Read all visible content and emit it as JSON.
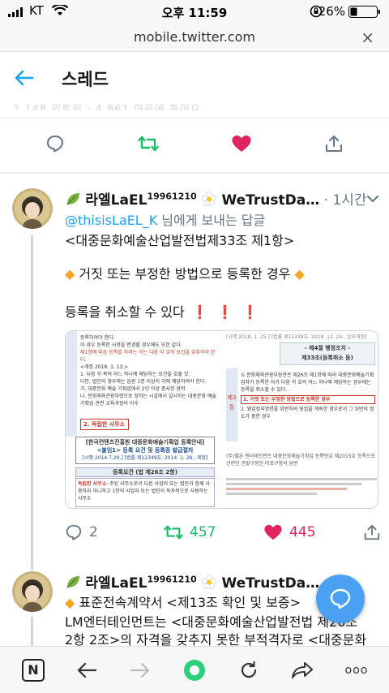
{
  "status_bar": {
    "carrier": "KT",
    "time": "오후 11:59",
    "battery": "26%"
  },
  "browser": {
    "url": "mobile.twitter.com",
    "close_label": "×"
  },
  "header": {
    "back_icon": "back-arrow-icon",
    "title": "스레드"
  },
  "prev_tweet": {
    "faded_text": "2,148 리트윗 · 4,861 마음에 들어요",
    "actions": [
      "reply",
      "retweet",
      "like",
      "share"
    ],
    "like_color": "#e0245e",
    "retweet_color": "#17bf63"
  },
  "tweet1": {
    "display_name": "라엘LaEL",
    "name_sup": "19961210",
    "name_suffix": "WeTrustDa…",
    "time": "· 1시간",
    "reply_to_prefix": "@thisisLaEL_K",
    "reply_to_suffix": " 님에게 보내는 답글",
    "lines": [
      "<대중문화예술산업발전법제33조 제1항>",
      "거짓 또는 부정한 방법으로 등록한 경우",
      "등록을 취소할 수 있다"
    ],
    "media_left": {
      "lines": [
        "등록하여야 한다.",
        "이 경우 등록한 사항을 변경할 경우에도 또한 같다.",
        "제1항에 따른 등록을 하려는 자는 다음 각 호의 요건을 갖추어야 한다.",
        "<개정 2018. 3. 13.>",
        "1. 다음 각 목의 어느 하나에 해당하는 요건을 갖출 것.",
        "다만, 법인의 경우에는 임원 1명 이상이 이에 해당하여야 한다.",
        "가. 대중문화 예술 기획업에서 2년 이상 종사한 경력",
        "나. 문화체육관광부령으로 정하는 시설에서 실시하는 대중문화 예술 기획업 관련 교육과정의 이수",
        "2. 독립한 사무소"
      ],
      "box_title": "[한국컨텐츠진흥원 대중문화예술기획업 등록안내]",
      "box_sub": "<붙임1> 등록 요건 및 등록증 발급절차",
      "box_date": "[시행 2014.7.29.] [법률 제12349호, 2014. 1. 28., 제정]",
      "req_title": "등록요건 (법 제26조 2항)",
      "req_item": "독립한 사무소",
      "req_text": ": 주된 사무소로서 다른 사업의 또는 법인과 함께 사용하지 아니하고 1인의 사업자 또는 법인이 독자적으로 사용하는 사무소"
    },
    "media_right": {
      "top_text": "[시행 2018. 1. 25.] [법률 제15338호, 2018. 12. 24., 일부개정]",
      "box_title": "- 제4절 행정조치 -",
      "box_sub": "제33조(등록취소 등)",
      "lines": [
        "① 문화체육관광부장관은 제26조 제1항에 따라 대중문화예술기획업자가 등록한 자가 다음 각 호의 어느 하나에 해당하는 경우에는 등록을 취소할 수 있다.",
        "1. 거짓 또는 부정한 방법으로 등록한 경우",
        "2. 영업정지명령을 위반하여 영업을 계속한 경우로서 그 위반의 정도가 중한 경우"
      ],
      "note": "(주)멜론 엔터테인먼트 대중문화예술기획업 등록번호 제2015호 등록으로 관련한 관할구청인 마포구청의 답변",
      "side_label": "제3장"
    },
    "replies": "2",
    "retweets": "457",
    "likes": "445"
  },
  "tweet2": {
    "display_name": "라엘LaEL",
    "name_sup": "19961210",
    "name_suffix": "WeTrustDa…",
    "lines": [
      "표준전속계약서 <제13조 확인 및 보증>",
      "LM엔터테인먼트는 <대중문화예술산업발전법 제26조",
      "2항 2조>의 자격을 갖추지 못한 부적격자로 <대중문화"
    ]
  },
  "fab": {
    "icon": "compose-icon"
  },
  "bottom_bar": {
    "items": [
      "naver-icon",
      "back-icon",
      "forward-icon",
      "home-icon",
      "reload-icon",
      "share-icon",
      "more-icon"
    ],
    "naver_label": "N",
    "more_label": "ooo"
  }
}
